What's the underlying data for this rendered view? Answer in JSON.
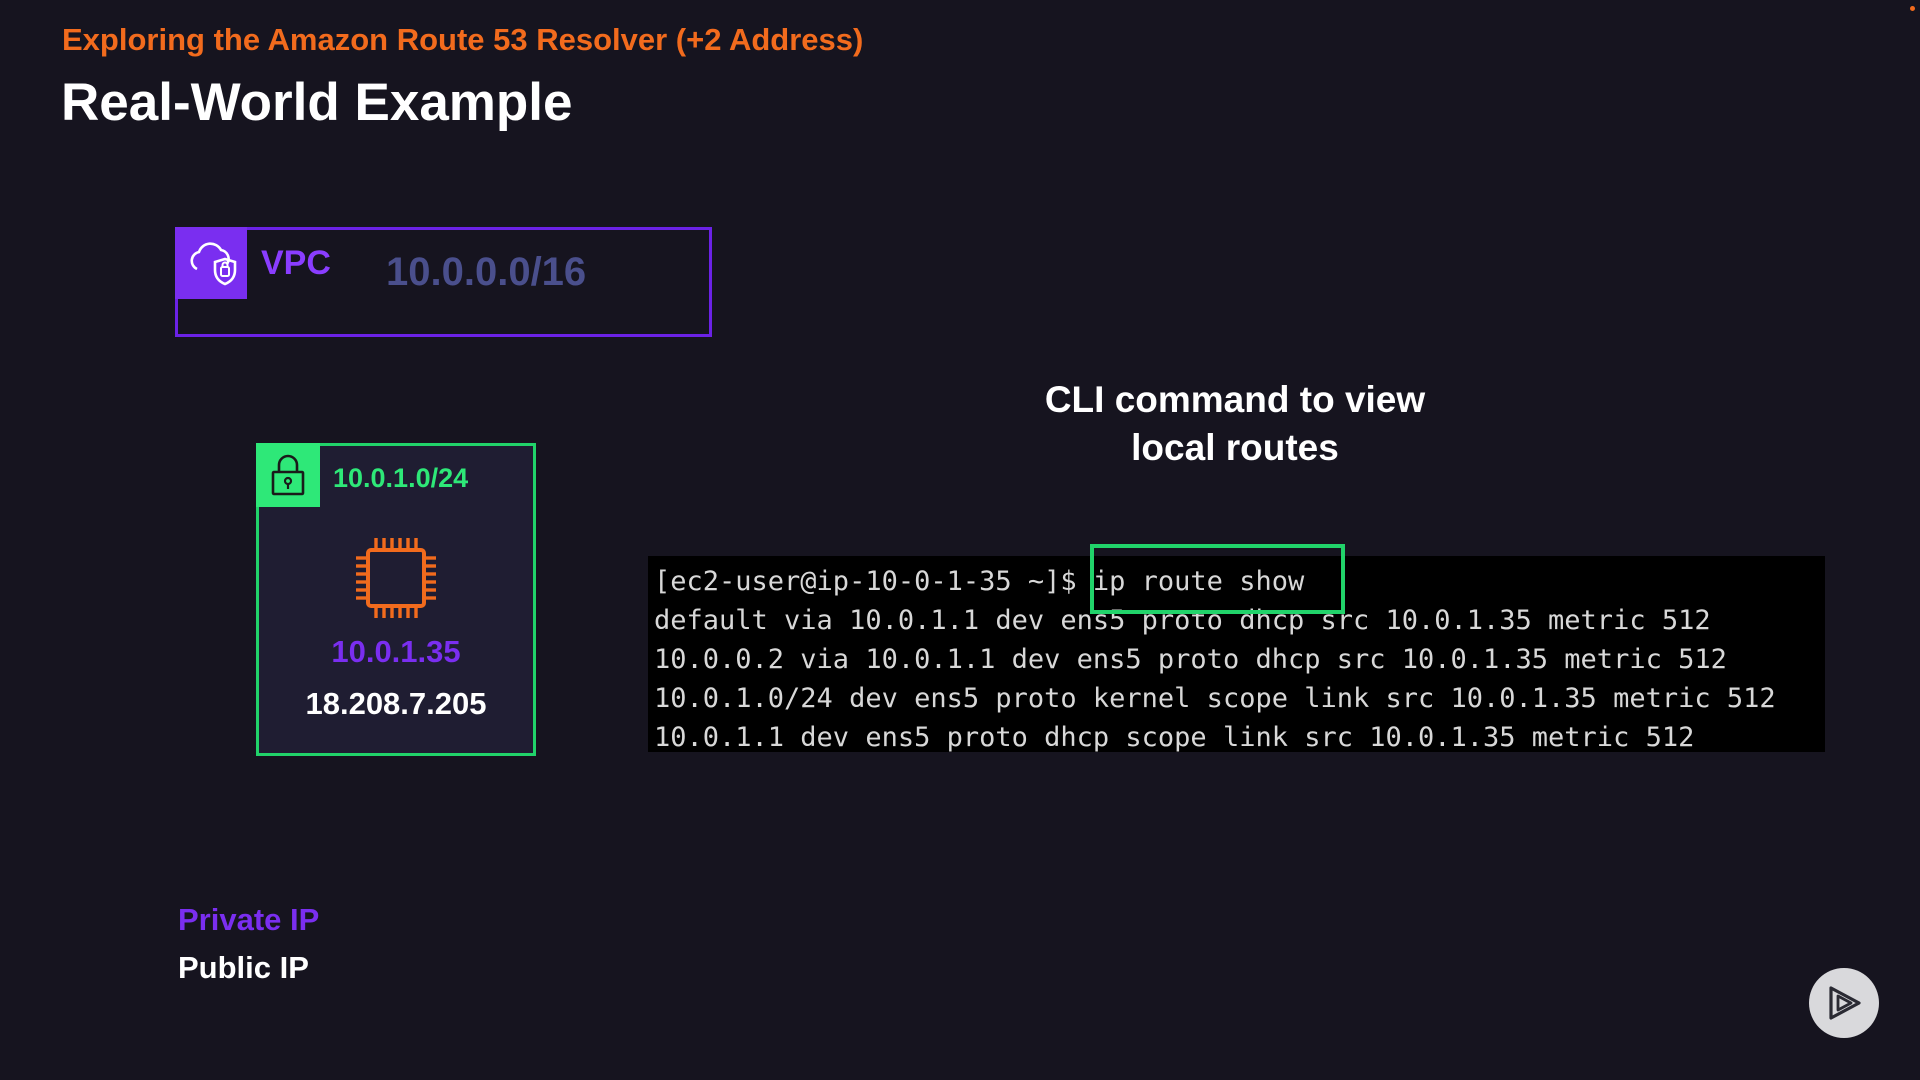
{
  "header": {
    "subtitle": "Exploring the Amazon Route 53 Resolver (+2 Address)",
    "title": "Real-World Example"
  },
  "vpc": {
    "label": "VPC",
    "cidr": "10.0.0.0/16",
    "icon": "vpc-cloud-shield-icon"
  },
  "subnet": {
    "cidr": "10.0.1.0/24",
    "icon": "lock-icon",
    "instance_icon": "ec2-chip-icon",
    "private_ip": "10.0.1.35",
    "public_ip": "18.208.7.205"
  },
  "cli_caption": {
    "line1": "CLI command to view",
    "line2": "local routes"
  },
  "terminal": {
    "lines": [
      "[ec2-user@ip-10-0-1-35 ~]$ ip route show",
      "default via 10.0.1.1 dev ens5 proto dhcp src 10.0.1.35 metric 512",
      "10.0.0.2 via 10.0.1.1 dev ens5 proto dhcp src 10.0.1.35 metric 512",
      "10.0.1.0/24 dev ens5 proto kernel scope link src 10.0.1.35 metric 512",
      "10.0.1.1 dev ens5 proto dhcp scope link src 10.0.1.35 metric 512"
    ]
  },
  "legend": {
    "private": "Private IP",
    "public": "Public IP"
  },
  "colors": {
    "background": "#16141f",
    "accent_orange": "#f26b1d",
    "vpc_purple": "#7a2ef0",
    "subnet_green": "#2ee878"
  }
}
